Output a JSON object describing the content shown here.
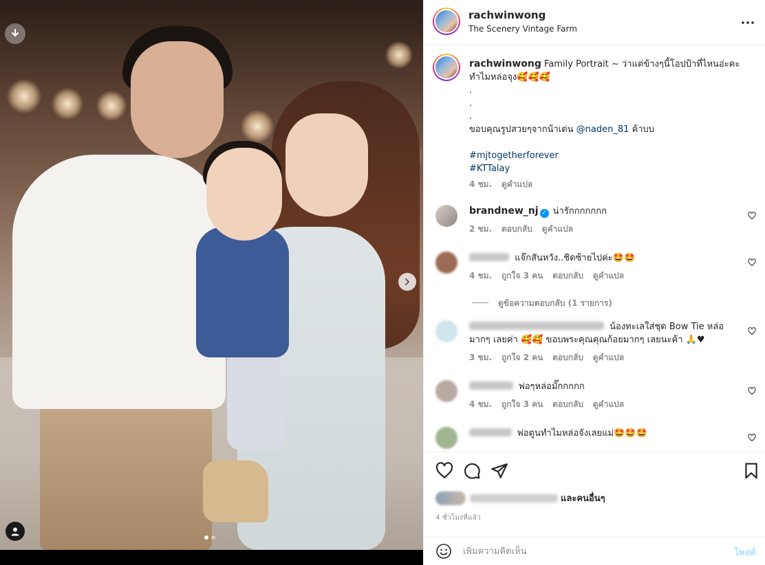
{
  "post": {
    "username": "rachwinwong",
    "location": "The Scenery Vintage Farm"
  },
  "caption": {
    "username": "rachwinwong",
    "text_line1": "Family Portrait ~ ว่าแต่ข้างๆนี้โอปป้าที่ไหนอ่ะคะ",
    "text_line2": "ทำไมหล่อจุง🥰🥰🥰",
    "dot1": ".",
    "dot2": ".",
    "dot3": ".",
    "thanks_prefix": "ขอบคุณรูปสวยๆจากน้าเด่น",
    "mention": "@naden_81",
    "thanks_suffix": "ค้าบบ",
    "hashtag1": "#mjtogetherforever",
    "hashtag2": "#KTTalay",
    "time": "4 ชม.",
    "translate": "ดูคำแปล"
  },
  "comments": [
    {
      "username": "brandnew_nj",
      "verified": true,
      "text": "น่ารักกกกกกก",
      "time": "2 ชม.",
      "likes": "",
      "reply": "ตอบกลับ",
      "translate": "ดูคำแปล"
    },
    {
      "username": "",
      "text": "แจ๊กสันหวัง..ชิดซ้ายไปค่ะ🤩🤩",
      "time": "4 ชม.",
      "likes": "ถูกใจ 3 คน",
      "reply": "ตอบกลับ",
      "translate": "ดูคำแปล"
    },
    {
      "username": "",
      "text_line1": "น้องทะเลใส่ชุด Bow Tie หล่อ",
      "text_line2": "มากๆ เลยค่า 🥰🥰 ขอบพระคุณคุณก้อยมากๆ เลยนะค้า 🙏♥",
      "time": "3 ชม.",
      "likes": "ถูกใจ 2 คน",
      "reply": "ตอบกลับ",
      "translate": "ดูคำแปล"
    },
    {
      "username": "",
      "text": "พ่อๆหล่อมั๊กกกกก",
      "time": "4 ชม.",
      "likes": "ถูกใจ 3 คน",
      "reply": "ตอบกลับ",
      "translate": "ดูคำแปล"
    },
    {
      "username": "",
      "text": "พ่อตูนทำไมหล่อจังเลยแม่🤩🤩🤩"
    }
  ],
  "view_replies": "ดูข้อความตอบกลับ (1 รายการ)",
  "likes_line": {
    "suffix": "และคนอื่นๆ"
  },
  "time_ago": "4 ชั่วโมงที่แล้ว",
  "add_comment": {
    "placeholder": "เพิ่มความคิดเห็น",
    "post_label": "โพสต์"
  },
  "colors": {
    "link": "#00376b",
    "verified": "#0095f6",
    "post_disabled": "#b2dffc",
    "meta": "#8e8e8e"
  },
  "icons": {
    "download": "download-icon",
    "next": "chevron-right-icon",
    "tags": "user-tag-icon",
    "more": "more-horizontal-icon",
    "heart": "heart-icon",
    "comment": "comment-icon",
    "share": "paper-plane-icon",
    "save": "bookmark-icon",
    "emoji": "emoji-icon"
  },
  "carousel": {
    "total": 2,
    "active": 1
  }
}
